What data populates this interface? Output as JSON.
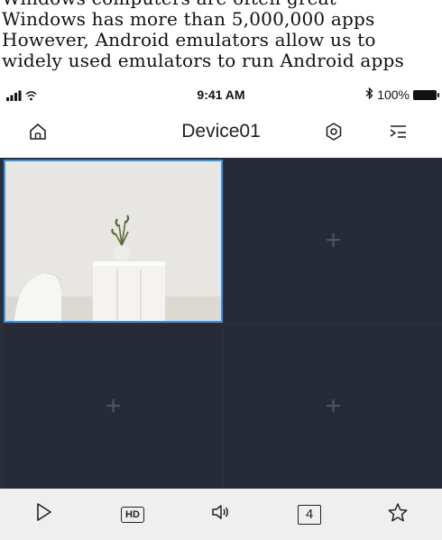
{
  "article": {
    "lines": [
      "Windows computers are often great",
      "Windows has more than 5,000,000 apps",
      "However, Android emulators allow us to",
      "widely used emulators to run Android apps"
    ]
  },
  "statusbar": {
    "time": "9:41 AM",
    "battery": "100%",
    "bluetooth_glyph": "✱"
  },
  "navbar": {
    "title": "Device01"
  },
  "grid": {
    "empty_glyph": "+"
  },
  "toolbar": {
    "hd_label": "HD",
    "split_label": "4"
  },
  "colors": {
    "accent": "#3b93e6",
    "grid_bg": "#262b37",
    "toolbar_bg": "#efefef"
  }
}
